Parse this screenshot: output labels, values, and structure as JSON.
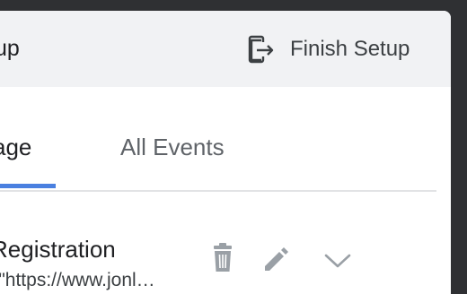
{
  "header": {
    "title_fragment": "tup",
    "finish_label": "Finish Setup"
  },
  "tabs": [
    {
      "label": "age",
      "active": true
    },
    {
      "label": "All Events",
      "active": false
    }
  ],
  "event": {
    "title": "Registration",
    "subtitle": "l: \"https://www.jonl…"
  },
  "icons": {
    "finish": "exit-icon",
    "delete": "trash-icon",
    "edit": "pencil-icon",
    "expand": "chevron-down-icon"
  },
  "colors": {
    "accent": "#4a80e0",
    "header_bg": "#f1f2f4",
    "icon_gray": "#9aa0a6"
  }
}
